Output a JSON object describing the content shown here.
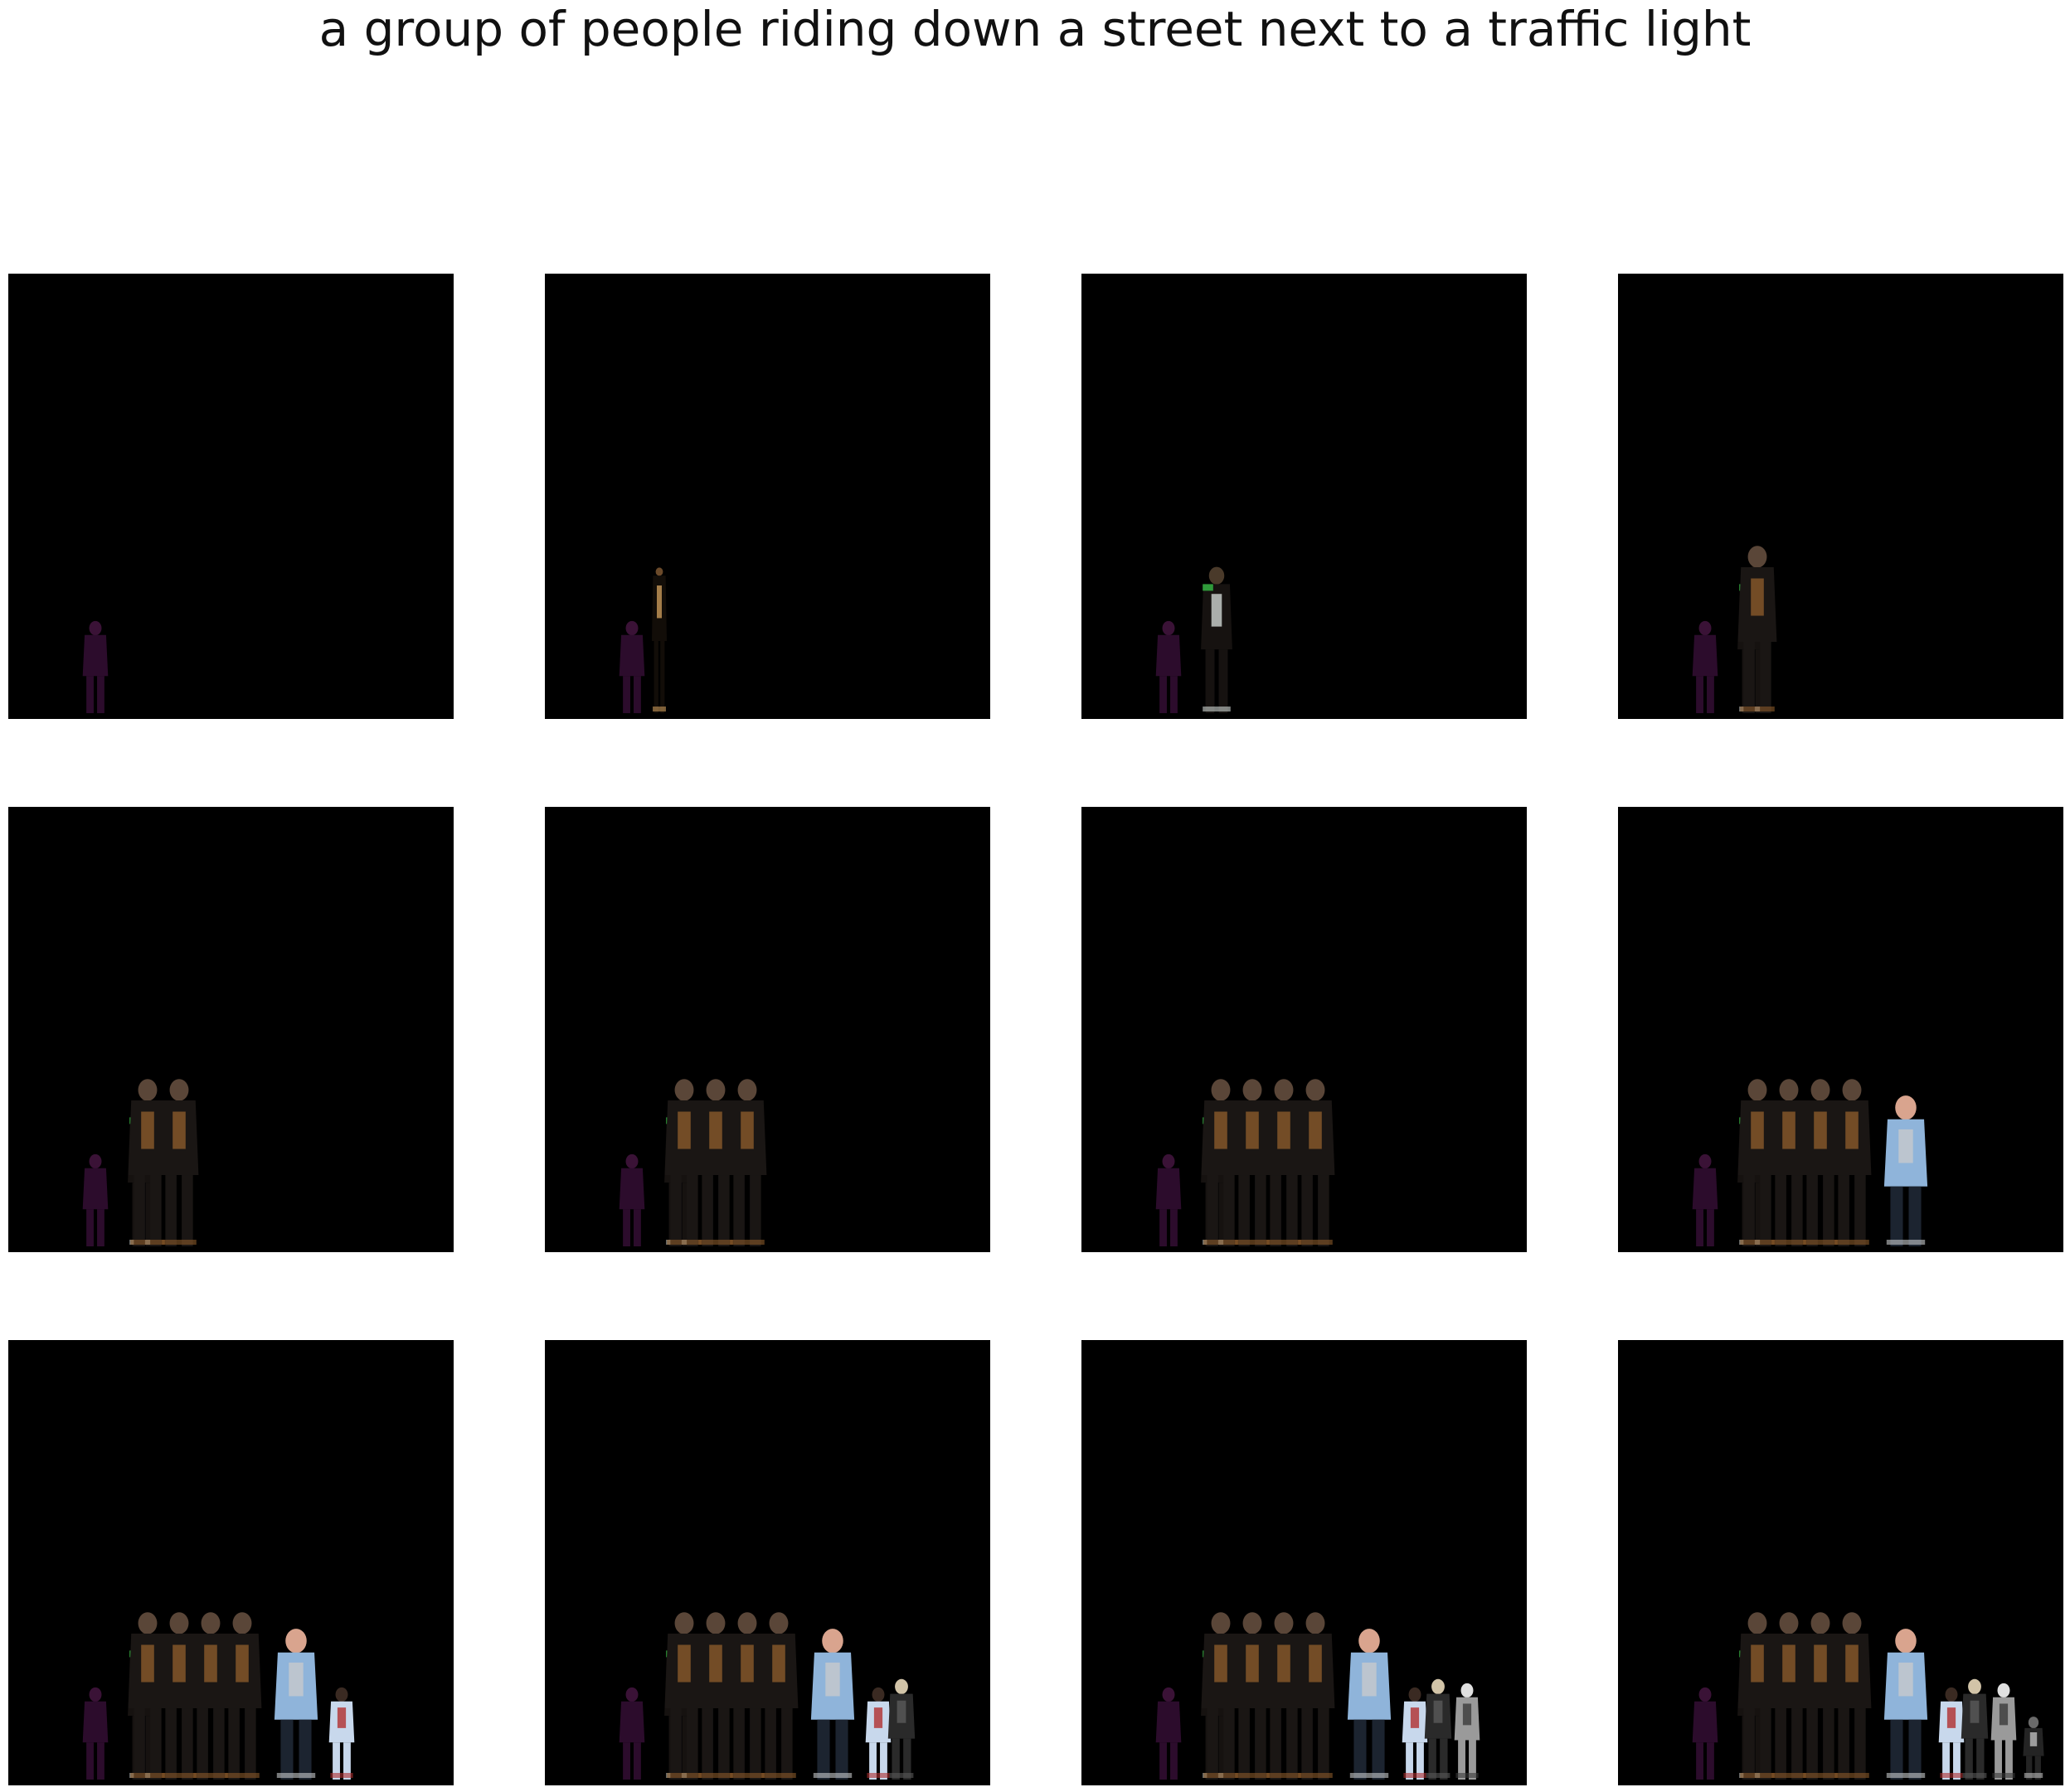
{
  "figure": {
    "caption": "a group of people riding down a street next to a traffic light",
    "background": "#ffffff",
    "panel_background": "#000000"
  },
  "frames": [
    {
      "index": 1,
      "figures": [
        "purple-silhouette"
      ]
    },
    {
      "index": 2,
      "figures": [
        "purple-silhouette",
        "sliver-figure"
      ]
    },
    {
      "index": 3,
      "figures": [
        "purple-silhouette",
        "woman-white-shirt"
      ]
    },
    {
      "index": 4,
      "figures": [
        "purple-silhouette",
        "woman-white-shirt",
        "dark-man"
      ]
    },
    {
      "index": 5,
      "figures": [
        "purple-silhouette",
        "woman-white-shirt",
        "dark-man",
        "dark-man"
      ]
    },
    {
      "index": 6,
      "figures": [
        "purple-silhouette",
        "woman-white-shirt",
        "dark-man",
        "dark-man",
        "dark-man"
      ]
    },
    {
      "index": 7,
      "figures": [
        "purple-silhouette",
        "woman-white-shirt",
        "dark-man",
        "dark-man",
        "dark-man",
        "dark-man"
      ]
    },
    {
      "index": 8,
      "figures": [
        "purple-silhouette",
        "woman-white-shirt",
        "dark-man",
        "dark-man",
        "dark-man",
        "dark-man",
        "woman-pink-hat-blue-cape"
      ]
    },
    {
      "index": 9,
      "figures": [
        "purple-silhouette",
        "woman-white-shirt",
        "dark-man",
        "dark-man",
        "dark-man",
        "dark-man",
        "woman-pink-hat-blue-cape",
        "man-light-jacket"
      ]
    },
    {
      "index": 10,
      "figures": [
        "purple-silhouette",
        "woman-white-shirt",
        "dark-man",
        "dark-man",
        "dark-man",
        "dark-man",
        "woman-pink-hat-blue-cape",
        "man-light-jacket",
        "man-dark-coat"
      ]
    },
    {
      "index": 11,
      "figures": [
        "purple-silhouette",
        "woman-white-shirt",
        "dark-man",
        "dark-man",
        "dark-man",
        "dark-man",
        "woman-pink-hat-blue-cape",
        "man-light-jacket",
        "man-dark-coat",
        "grey-figure"
      ]
    },
    {
      "index": 12,
      "figures": [
        "purple-silhouette",
        "woman-white-shirt",
        "dark-man",
        "dark-man",
        "dark-man",
        "dark-man",
        "woman-pink-hat-blue-cape",
        "man-light-jacket",
        "man-dark-coat",
        "grey-figure",
        "small-dark-figure"
      ]
    }
  ]
}
